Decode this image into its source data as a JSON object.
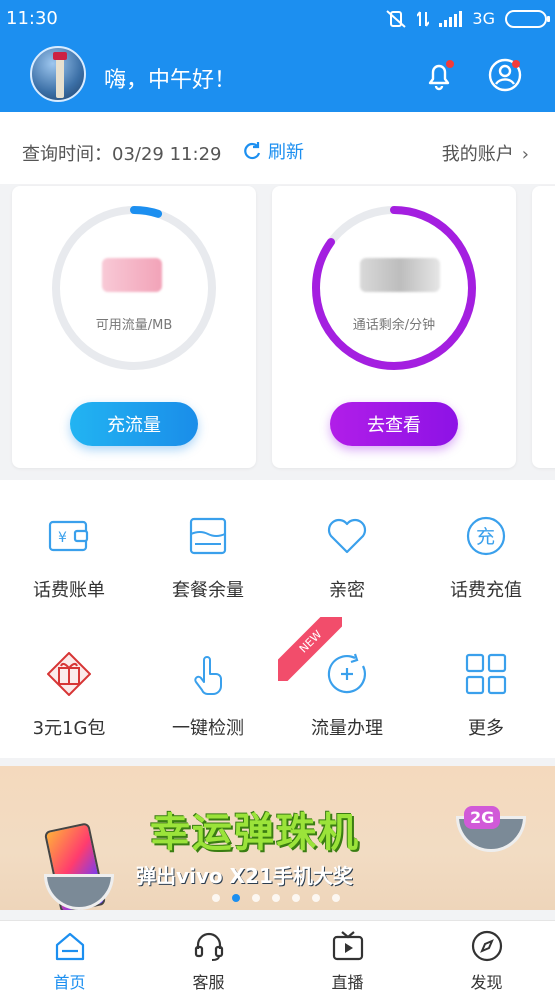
{
  "status_bar": {
    "time": "11:30",
    "network": "3G"
  },
  "header": {
    "greeting": "嗨，中午好！",
    "bell_icon": "bell-icon",
    "user_icon": "user-icon"
  },
  "query": {
    "time_label": "查询时间：03/29 11:29",
    "refresh_label": "刷新",
    "account_label": "我的账户"
  },
  "cards": [
    {
      "label": "可用流量/MB",
      "button": "充流量",
      "progress": 0.05,
      "color": "#1c8ff0"
    },
    {
      "label": "通话剩余/分钟",
      "button": "去查看",
      "progress": 0.85,
      "color": "#a41fe0"
    }
  ],
  "grid": [
    {
      "label": "话费账单",
      "icon": "wallet-icon"
    },
    {
      "label": "套餐余量",
      "icon": "package-icon"
    },
    {
      "label": "亲密",
      "icon": "heart-icon"
    },
    {
      "label": "话费充值",
      "icon": "recharge-icon"
    },
    {
      "label": "3元1G包",
      "icon": "gift-icon"
    },
    {
      "label": "一键检测",
      "icon": "touch-icon"
    },
    {
      "label": "流量办理",
      "icon": "plus-circle-icon"
    },
    {
      "label": "更多",
      "icon": "more-grid-icon"
    }
  ],
  "new_badge": "NEW",
  "banner": {
    "title": "幸运弹珠机",
    "subtitle": "弹出vivo X21手机大奖",
    "tag": "2G",
    "active_dot": 1,
    "dot_count": 7
  },
  "nav": [
    {
      "label": "首页",
      "icon": "home-icon",
      "active": true
    },
    {
      "label": "客服",
      "icon": "headset-icon",
      "active": false
    },
    {
      "label": "直播",
      "icon": "tv-icon",
      "active": false
    },
    {
      "label": "发现",
      "icon": "compass-icon",
      "active": false
    }
  ]
}
